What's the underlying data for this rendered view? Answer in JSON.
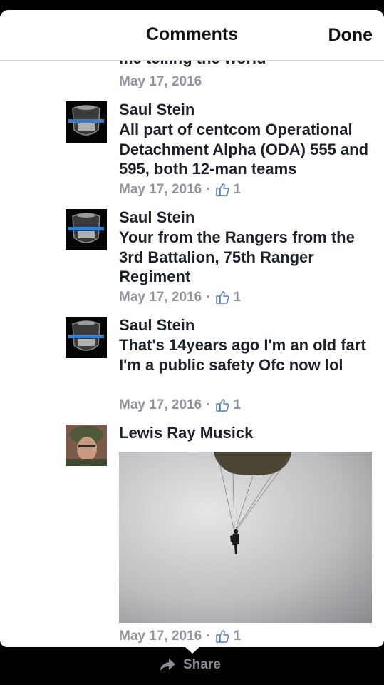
{
  "header": {
    "title": "Comments",
    "done_label": "Done"
  },
  "top_partial": {
    "text": "me telling the world",
    "timestamp": "May 17, 2016"
  },
  "comments": [
    {
      "author": "Saul Stein",
      "text": "All part of centcom Operational Detachment Alpha (ODA) 555 and 595, both 12-man teams",
      "timestamp": "May 17, 2016",
      "separator": "·",
      "likes": "1"
    },
    {
      "author": "Saul Stein",
      "text": "Your from the Rangers from the 3rd Battalion, 75th Ranger Regiment",
      "timestamp": "May 17, 2016",
      "separator": "·",
      "likes": "1"
    },
    {
      "author": "Saul Stein",
      "text": "That's 14years ago I'm an old fart I'm a public safety Ofc now lol",
      "timestamp": "May 17, 2016",
      "separator": "·",
      "likes": "1"
    },
    {
      "author": "Lewis Ray Musick",
      "text": "",
      "timestamp": "May 17, 2016",
      "separator": "·",
      "likes": "1",
      "attachment": "photo-parachutist"
    }
  ],
  "footer": {
    "share_label": "Share"
  },
  "colors": {
    "text": "#1d2129",
    "meta": "#90949c",
    "divider": "#d6d6d6",
    "badge_stripe": "#2f7fd8"
  },
  "icons": {
    "like": "thumbs-up-icon",
    "share": "share-arrow-icon"
  }
}
